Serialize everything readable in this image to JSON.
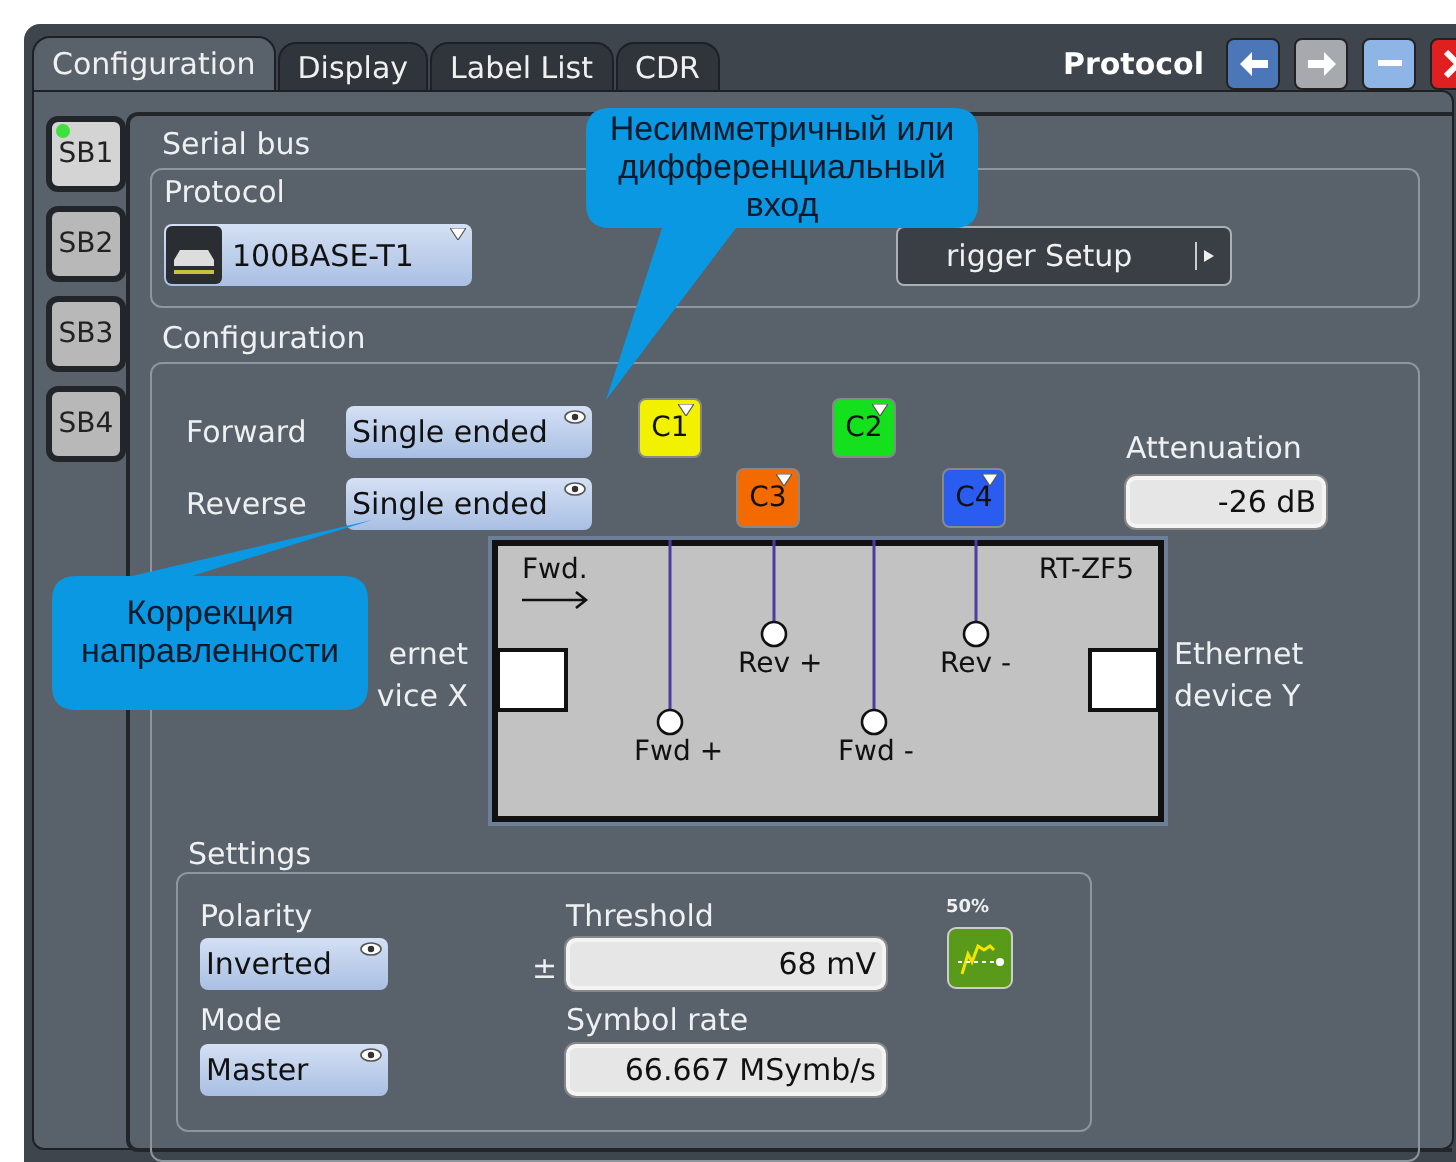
{
  "window": {
    "title": "Protocol"
  },
  "tabs": [
    {
      "label": "Configuration",
      "selected": true
    },
    {
      "label": "Display",
      "selected": false
    },
    {
      "label": "Label List",
      "selected": false
    },
    {
      "label": "CDR",
      "selected": false
    }
  ],
  "window_buttons": [
    {
      "kind": "back",
      "disabled": false
    },
    {
      "kind": "forward",
      "disabled": true
    },
    {
      "kind": "minimize",
      "disabled": false
    },
    {
      "kind": "close",
      "disabled": false
    }
  ],
  "bus_tabs": [
    {
      "label": "SB1",
      "selected": true,
      "active": true
    },
    {
      "label": "SB2",
      "selected": false,
      "active": false
    },
    {
      "label": "SB3",
      "selected": false,
      "active": false
    },
    {
      "label": "SB4",
      "selected": false,
      "active": false
    }
  ],
  "serial_bus": {
    "title": "Serial bus",
    "protocol_label": "Protocol",
    "protocol": "100BASE-T1",
    "trigger_setup": "rigger Setup"
  },
  "configuration": {
    "title": "Configuration",
    "inputs": [
      {
        "label": "Forward",
        "value": "Single ended"
      },
      {
        "label": "Reverse",
        "value": "Single ended"
      }
    ],
    "channels": [
      {
        "label": "C1",
        "color": "#f2f200"
      },
      {
        "label": "C2",
        "color": "#14e01e"
      },
      {
        "label": "C3",
        "color": "#f26a00"
      },
      {
        "label": "C4",
        "color": "#2a5cf0"
      }
    ],
    "attenuation": {
      "label": "Attenuation",
      "value": "-26 dB"
    },
    "diagram": {
      "direction": "Fwd.",
      "probe": "RT-ZF5",
      "device_left": [
        "ernet",
        "vice X"
      ],
      "device_right": [
        "Ethernet",
        "device Y"
      ],
      "pins": [
        {
          "label": "Fwd +",
          "kind": "fwd"
        },
        {
          "label": "Rev +",
          "kind": "rev"
        },
        {
          "label": "Fwd -",
          "kind": "fwd"
        },
        {
          "label": "Rev -",
          "kind": "rev"
        }
      ]
    }
  },
  "settings": {
    "title": "Settings",
    "polarity_label": "Polarity",
    "polarity": "Inverted",
    "mode_label": "Mode",
    "mode": "Master",
    "threshold_label": "Threshold",
    "threshold_sign": "±",
    "threshold": "68 mV",
    "symbol_rate_label": "Symbol rate",
    "symbol_rate": "66.667 MSymb/s",
    "auto_label": "50%"
  },
  "callouts": [
    {
      "lines": [
        "Несимметричный или",
        "дифференциальный",
        "вход"
      ]
    },
    {
      "lines": [
        "Коррекция",
        "направленности"
      ]
    }
  ]
}
